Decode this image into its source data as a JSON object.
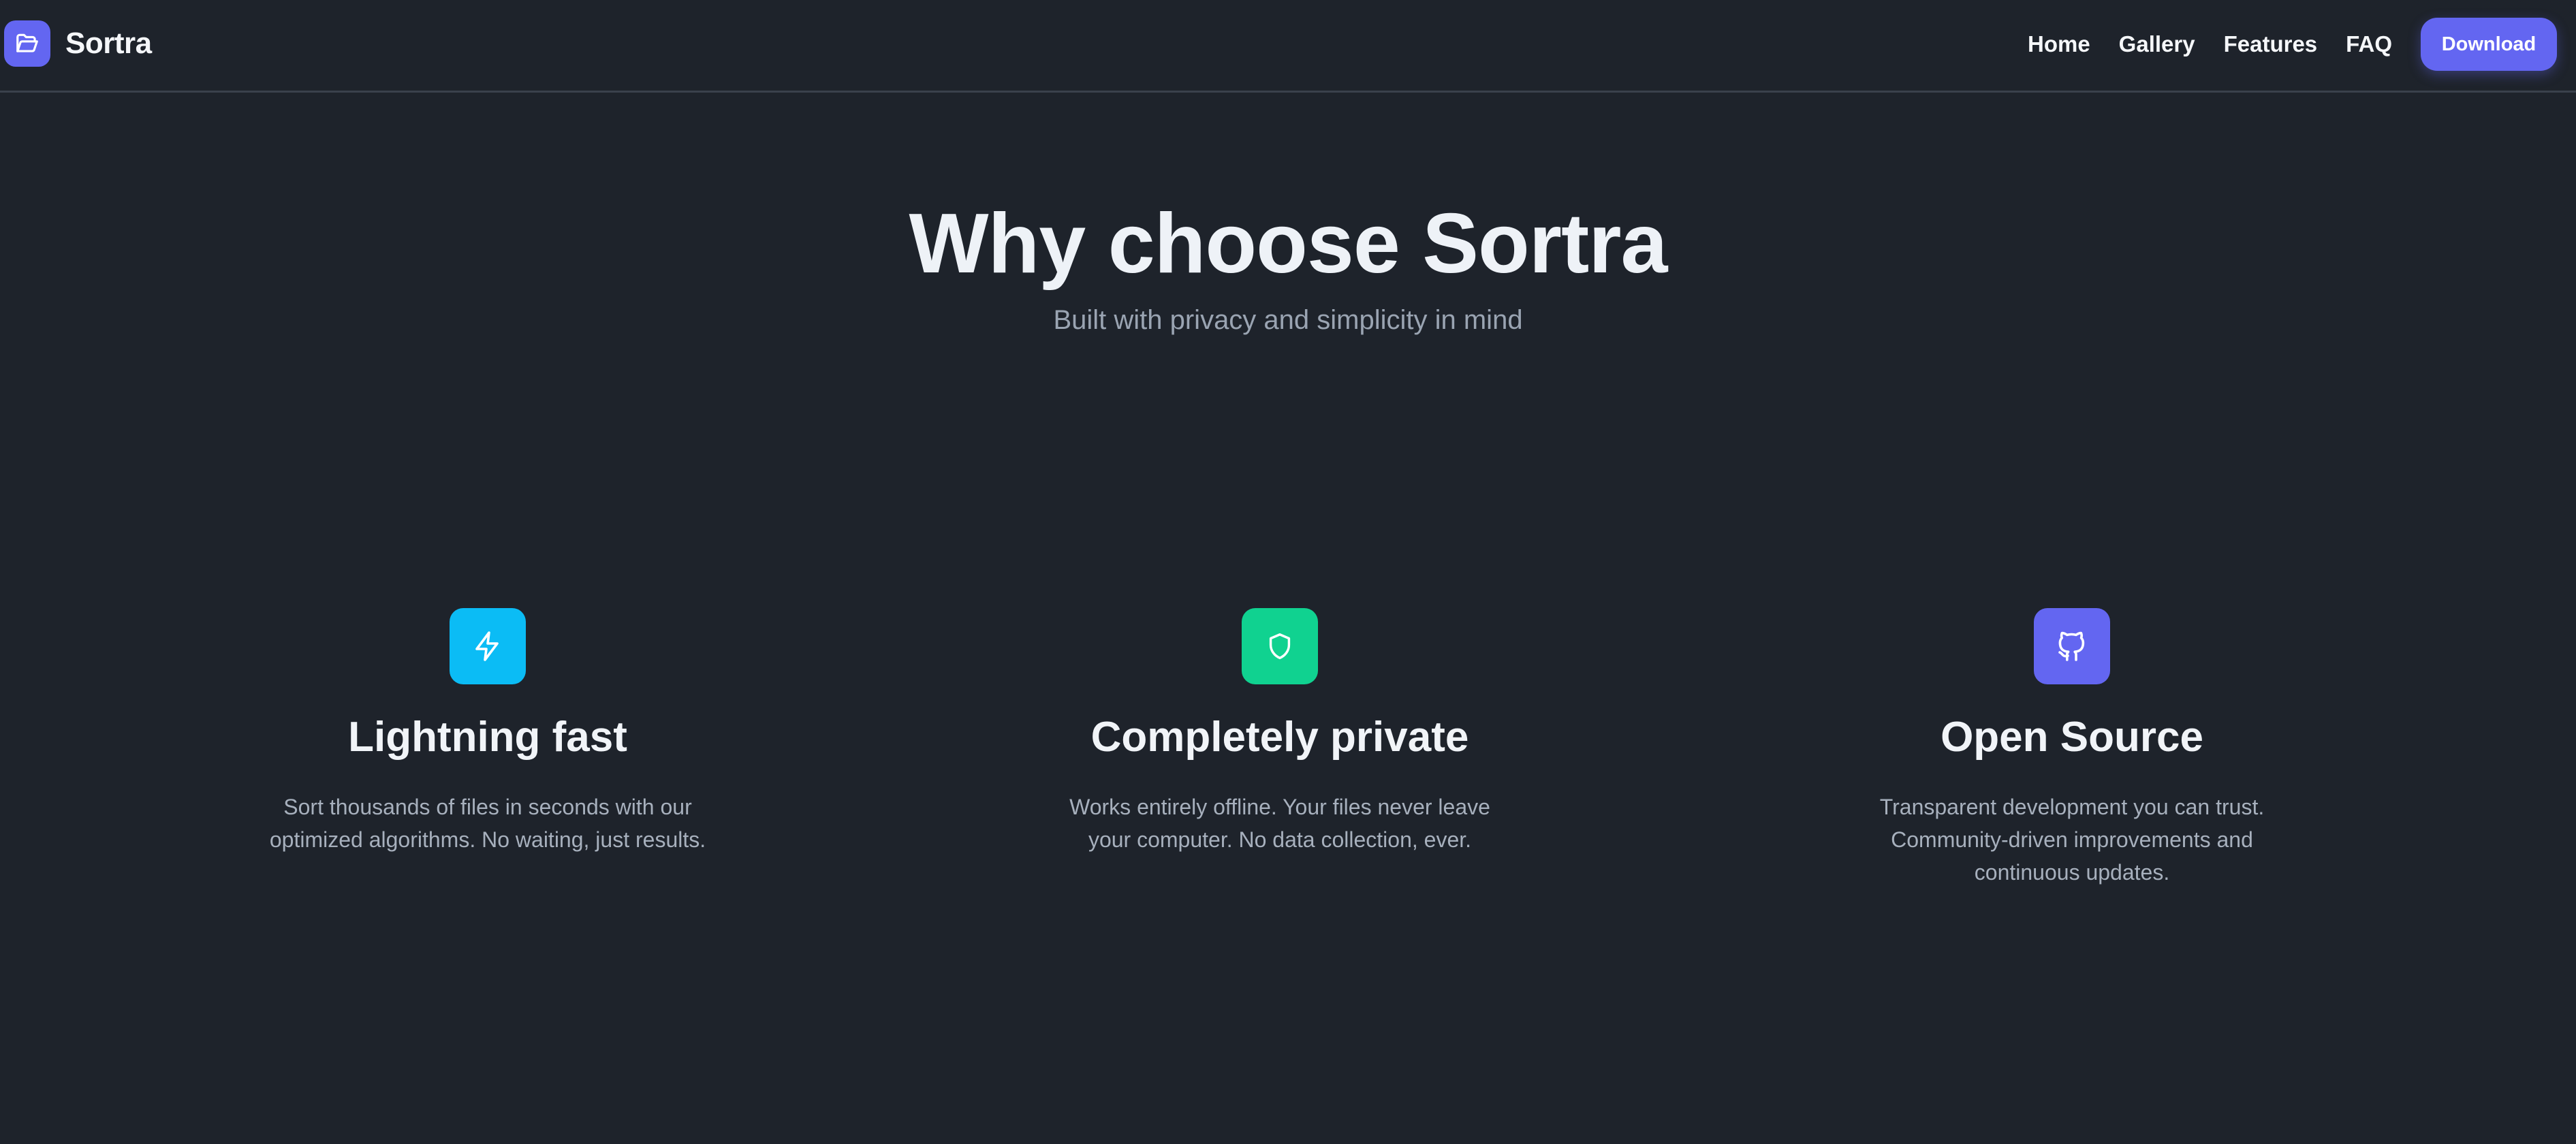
{
  "brand": {
    "name": "Sortra",
    "icon": "folder-open-icon",
    "accent": "#6366f1"
  },
  "nav": {
    "links": [
      "Home",
      "Gallery",
      "Features",
      "FAQ"
    ],
    "download_label": "Download"
  },
  "hero": {
    "title": "Why choose Sortra",
    "subtitle": "Built with privacy and simplicity in mind"
  },
  "features": [
    {
      "icon": "lightning-icon",
      "color": "#0bbcf5",
      "title": "Lightning fast",
      "description": "Sort thousands of files in seconds with our optimized algorithms. No waiting, just results."
    },
    {
      "icon": "shield-icon",
      "color": "#10d290",
      "title": "Completely private",
      "description": "Works entirely offline. Your files never leave your computer. No data collection, ever."
    },
    {
      "icon": "github-icon",
      "color": "#6366f1",
      "title": "Open Source",
      "description": "Transparent development you can trust. Community-driven improvements and continuous updates."
    }
  ],
  "colors": {
    "background": "#1e232b",
    "heading": "#eef2f7",
    "muted_text": "#9aa4b2"
  }
}
